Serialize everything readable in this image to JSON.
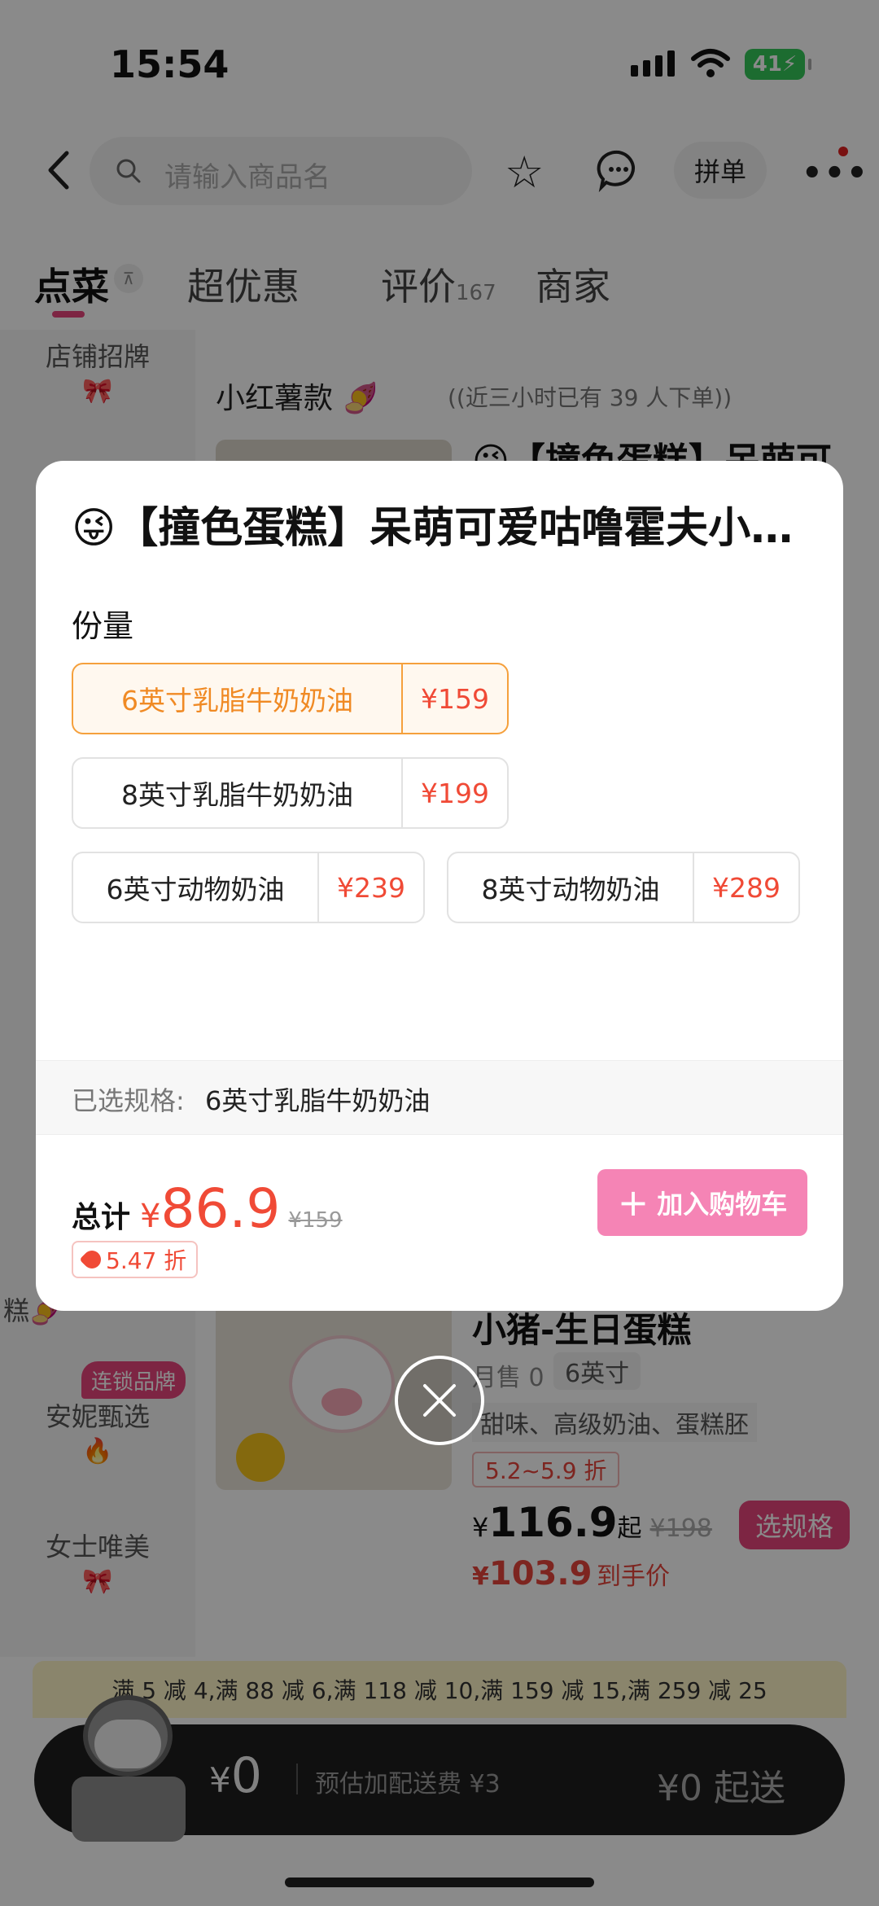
{
  "status": {
    "time": "15:54",
    "battery": "41"
  },
  "nav": {
    "search_placeholder": "请输入商品名",
    "pindan": "拼单"
  },
  "tabs": [
    {
      "label": "点菜"
    },
    {
      "label": "超优惠"
    },
    {
      "label": "评价",
      "count": "167"
    },
    {
      "label": "商家"
    }
  ],
  "sidebar": {
    "items": [
      {
        "label": "店铺招牌",
        "icon": "bow-icon"
      },
      {
        "label": "糕",
        "icon": "sweet-potato-icon"
      },
      {
        "label": "安妮甄选",
        "icon": "fire-icon"
      },
      {
        "label": "女士唯美",
        "icon": "bow-icon"
      }
    ],
    "chain_badge": "连锁品牌"
  },
  "content": {
    "category_title": "小红薯款",
    "category_sub": "((近三小时已有 39 人下单))",
    "item1_title": "😜【撞色蛋糕】呆萌可",
    "item2": {
      "title": "小猪-生日蛋糕",
      "sold": "月售 0",
      "size": "6英寸",
      "desc": "甜味、高级奶油、蛋糕胚",
      "discount": "5.2~5.9 折",
      "price_yen": "¥",
      "price": "116.9",
      "price_from": "起",
      "orig": "¥198",
      "choose_btn": "选规格",
      "final_yen": "¥",
      "final": "103.9",
      "final_label": "到手价"
    }
  },
  "promo": "满 5 减 4,满 88 减 6,满 118 减 10,满 159 减 15,满 259 减 25",
  "cart": {
    "yen": "¥",
    "total": "0",
    "fee": "预估加配送费 ¥3",
    "min": "¥0 起送"
  },
  "modal": {
    "title": "😜【撞色蛋糕】呆萌可爱咕噜霍夫小红薯蛋糕",
    "section": "份量",
    "options": [
      {
        "name": "6英寸乳脂牛奶奶油",
        "price": "¥159",
        "selected": true
      },
      {
        "name": "8英寸乳脂牛奶奶油",
        "price": "¥199",
        "selected": false
      },
      {
        "name": "6英寸动物奶油",
        "price": "¥239",
        "selected": false
      },
      {
        "name": "8英寸动物奶油",
        "price": "¥289",
        "selected": false
      }
    ],
    "selected_label": "已选规格:",
    "selected_value": "6英寸乳脂牛奶奶油",
    "total_label": "总计",
    "total_yen": "¥",
    "total_value": "86.9",
    "total_orig": "¥159",
    "discount": "5.47 折",
    "add_label": "加入购物车"
  },
  "colors": {
    "accent": "#e8457d",
    "price": "#f04a36",
    "selected": "#f5a03c",
    "add_button": "#f584b5"
  }
}
